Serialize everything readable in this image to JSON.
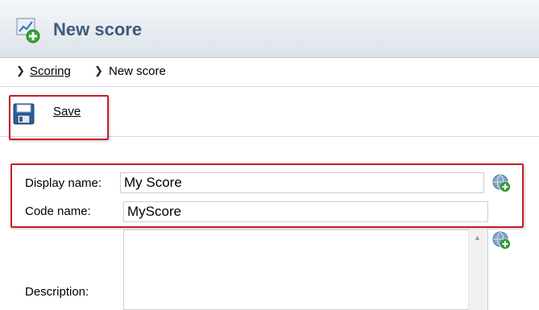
{
  "header": {
    "title": "New score",
    "icon": "new-score-chart-icon"
  },
  "breadcrumb": {
    "link": "Scoring",
    "current": "New score",
    "separator_icon": "chevron-right-icon"
  },
  "toolbar": {
    "save_label": "Save",
    "save_icon": "floppy-disk-icon"
  },
  "form": {
    "display_name": {
      "label": "Display name:",
      "value": "My Score"
    },
    "code_name": {
      "label": "Code name:",
      "value": "MyScore"
    },
    "description": {
      "label": "Description:",
      "value": ""
    }
  },
  "colors": {
    "highlight_red": "#c32027",
    "title_blue": "#3e5b7b"
  }
}
